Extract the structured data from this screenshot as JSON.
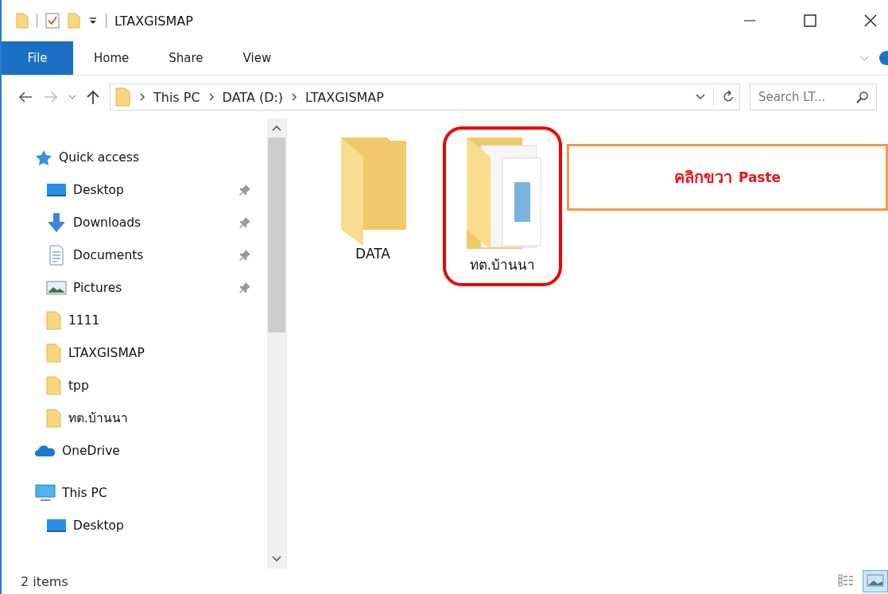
{
  "window": {
    "title": "LTAXGISMAP"
  },
  "ribbon": {
    "file_button": "File",
    "tabs": [
      {
        "label": "Home"
      },
      {
        "label": "Share"
      },
      {
        "label": "View"
      }
    ]
  },
  "address_bar": {
    "path": [
      "This PC",
      "DATA (D:)",
      "LTAXGISMAP"
    ]
  },
  "search": {
    "placeholder": "Search LT..."
  },
  "sidebar": {
    "items": [
      {
        "label": "Quick access",
        "kind": "star",
        "children": [
          {
            "label": "Desktop",
            "kind": "desktop",
            "pinned": true
          },
          {
            "label": "Downloads",
            "kind": "download",
            "pinned": true
          },
          {
            "label": "Documents",
            "kind": "document",
            "pinned": true
          },
          {
            "label": "Pictures",
            "kind": "pictures",
            "pinned": true
          },
          {
            "label": "1111",
            "kind": "folder",
            "pinned": false
          },
          {
            "label": "LTAXGISMAP",
            "kind": "folder",
            "pinned": false
          },
          {
            "label": "tpp",
            "kind": "folder",
            "pinned": false
          },
          {
            "label": "ทต.บ้านนา",
            "kind": "folder",
            "pinned": false
          }
        ]
      },
      {
        "label": "OneDrive",
        "kind": "cloud"
      },
      {
        "label": "This PC",
        "kind": "pc",
        "children": [
          {
            "label": "Desktop",
            "kind": "desktop",
            "pinned": false
          }
        ]
      }
    ]
  },
  "files": [
    {
      "name": "DATA",
      "kind": "folder",
      "highlighted": false
    },
    {
      "name": "ทต.บ้านนา",
      "kind": "folder_with_files",
      "highlighted": true
    }
  ],
  "callout": {
    "thai": "คลิกขวา",
    "english": "Paste"
  },
  "status_bar": {
    "count": "2 items",
    "views": [
      {
        "kind": "details",
        "selected": false
      },
      {
        "kind": "large_icons",
        "selected": true
      }
    ]
  }
}
